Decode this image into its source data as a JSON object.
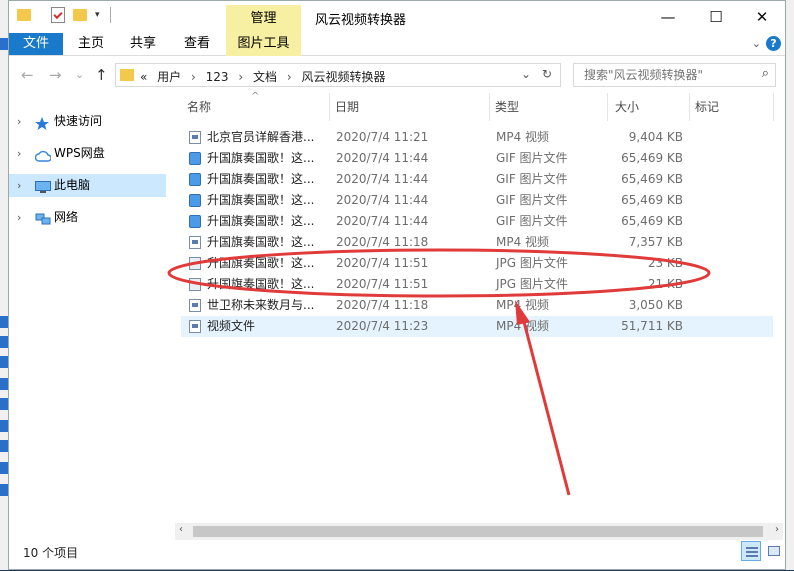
{
  "window": {
    "title": "风云视频转换器",
    "manage_tab": "管理",
    "minimize": "—",
    "maximize": "☐",
    "close": "✕"
  },
  "ribbon": {
    "tabs": [
      "文件",
      "主页",
      "共享",
      "查看",
      "图片工具"
    ],
    "collapse": "⌄",
    "help": "?"
  },
  "address": {
    "back": "←",
    "forward": "→",
    "recent": "⌄",
    "up": "↑",
    "prefix": "«",
    "crumbs": [
      "用户",
      "123",
      "文档",
      "风云视频转换器"
    ],
    "sep": "›",
    "dropdown": "⌄",
    "refresh": "↻"
  },
  "search": {
    "placeholder": "搜索\"风云视频转换器\"",
    "icon": "⌕"
  },
  "nav": {
    "items": [
      {
        "label": "快速访问",
        "icon": "star-icon",
        "color": "#2a7bd5"
      },
      {
        "label": "WPS网盘",
        "icon": "cloud-icon",
        "color": "#3a86d8"
      },
      {
        "label": "此电脑",
        "icon": "computer-icon",
        "color": "#3a86d8"
      },
      {
        "label": "网络",
        "icon": "network-icon",
        "color": "#3a86d8"
      }
    ],
    "expand": "›"
  },
  "columns": {
    "name": "名称",
    "date": "日期",
    "type": "类型",
    "size": "大小",
    "tags": "标记",
    "sort": "^"
  },
  "files": [
    {
      "name": "北京官员详解香港...",
      "date": "2020/7/4 11:21",
      "type": "MP4 视频",
      "size": "9,404 KB",
      "kind": "mp4"
    },
    {
      "name": "升国旗奏国歌！这...",
      "date": "2020/7/4 11:44",
      "type": "GIF 图片文件",
      "size": "65,469 KB",
      "kind": "gif"
    },
    {
      "name": "升国旗奏国歌！这...",
      "date": "2020/7/4 11:44",
      "type": "GIF 图片文件",
      "size": "65,469 KB",
      "kind": "gif"
    },
    {
      "name": "升国旗奏国歌！这...",
      "date": "2020/7/4 11:44",
      "type": "GIF 图片文件",
      "size": "65,469 KB",
      "kind": "gif"
    },
    {
      "name": "升国旗奏国歌！这...",
      "date": "2020/7/4 11:44",
      "type": "GIF 图片文件",
      "size": "65,469 KB",
      "kind": "gif"
    },
    {
      "name": "升国旗奏国歌！这...",
      "date": "2020/7/4 11:18",
      "type": "MP4 视频",
      "size": "7,357 KB",
      "kind": "mp4"
    },
    {
      "name": "升国旗奏国歌！这...",
      "date": "2020/7/4 11:51",
      "type": "JPG 图片文件",
      "size": "23 KB",
      "kind": "jpg"
    },
    {
      "name": "升国旗奏国歌！这...",
      "date": "2020/7/4 11:51",
      "type": "JPG 图片文件",
      "size": "21 KB",
      "kind": "jpg"
    },
    {
      "name": "世卫称未来数月与...",
      "date": "2020/7/4 11:18",
      "type": "MP4 视频",
      "size": "3,050 KB",
      "kind": "mp4"
    },
    {
      "name": "视频文件",
      "date": "2020/7/4 11:23",
      "type": "MP4 视频",
      "size": "51,711 KB",
      "kind": "mp4"
    }
  ],
  "scroll": {
    "left": "‹",
    "right": "›"
  },
  "status": {
    "count": "10 个项目"
  },
  "annotation_color": "#e03a3a"
}
